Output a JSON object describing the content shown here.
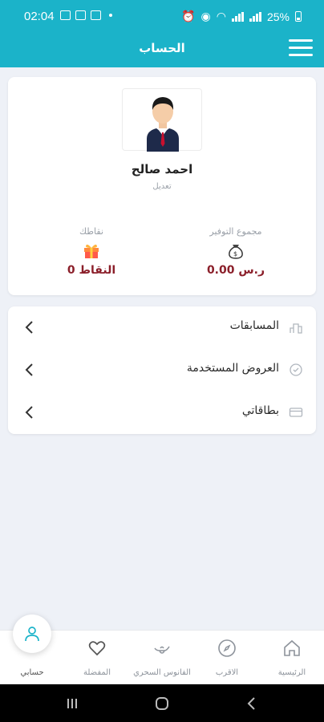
{
  "status_bar": {
    "time": "02:04",
    "battery": "25%"
  },
  "header": {
    "title": "الحساب",
    "menu_icon": "hamburger-menu-icon"
  },
  "profile": {
    "name": "احمد صالح",
    "edit_label": "تعديل",
    "savings": {
      "label": "مجموع التوفير",
      "value": "0.00 ر.س",
      "icon": "money-bag-icon"
    },
    "points": {
      "label": "نقاطك",
      "value": "0 النقاط",
      "icon": "gift-box-icon"
    }
  },
  "menu": {
    "items": [
      {
        "label": "المسابقات",
        "icon": "podium-icon"
      },
      {
        "label": "العروض المستخدمة",
        "icon": "used-offers-icon"
      },
      {
        "label": "بطاقاتي",
        "icon": "card-icon"
      }
    ]
  },
  "bottom_nav": {
    "items": [
      {
        "label": "الرئيسية",
        "icon": "home-icon"
      },
      {
        "label": "الاقرب",
        "icon": "compass-icon"
      },
      {
        "label": "الفانوس السحري",
        "icon": "magic-lamp-icon"
      },
      {
        "label": "المفضلة",
        "icon": "heart-icon"
      },
      {
        "label": "حسابي",
        "icon": "user-icon",
        "active": true
      }
    ]
  },
  "colors": {
    "primary": "#1bb3c9",
    "value_text": "#8b1f2a",
    "background": "#eef1f7"
  }
}
